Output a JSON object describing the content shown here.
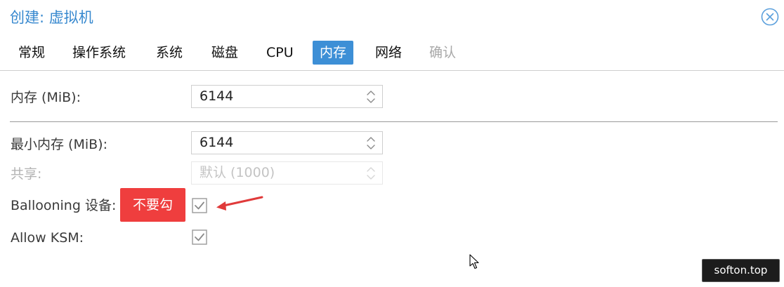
{
  "dialog": {
    "title": "创建: 虚拟机"
  },
  "tabs": [
    {
      "label": "常规",
      "state": "normal"
    },
    {
      "label": "操作系统",
      "state": "normal"
    },
    {
      "label": "系统",
      "state": "normal"
    },
    {
      "label": "磁盘",
      "state": "normal"
    },
    {
      "label": "CPU",
      "state": "normal"
    },
    {
      "label": "内存",
      "state": "active"
    },
    {
      "label": "网络",
      "state": "normal"
    },
    {
      "label": "确认",
      "state": "disabled"
    }
  ],
  "form": {
    "memory": {
      "label": "内存 (MiB):",
      "value": "6144"
    },
    "min_memory": {
      "label": "最小内存 (MiB):",
      "value": "6144"
    },
    "shares": {
      "label": "共享:",
      "placeholder": "默认 (1000)",
      "disabled": true
    },
    "ballooning": {
      "label": "Ballooning 设备:",
      "checked": true
    },
    "allow_ksm": {
      "label": "Allow KSM:",
      "checked": true
    }
  },
  "annotation": {
    "text": "不要勾",
    "color": "#ef3e3e"
  },
  "watermark": {
    "text": "softon.top"
  },
  "colors": {
    "accent": "#3d8fd6",
    "title": "#3889cf",
    "disabled_text": "#b3b3b3",
    "arrow": "#e03a3a"
  },
  "icons": {
    "close": "close-circle-icon",
    "spinner": "spinner-updown-icon",
    "checkbox": "checkmark-icon",
    "cursor": "mouse-cursor-icon"
  }
}
